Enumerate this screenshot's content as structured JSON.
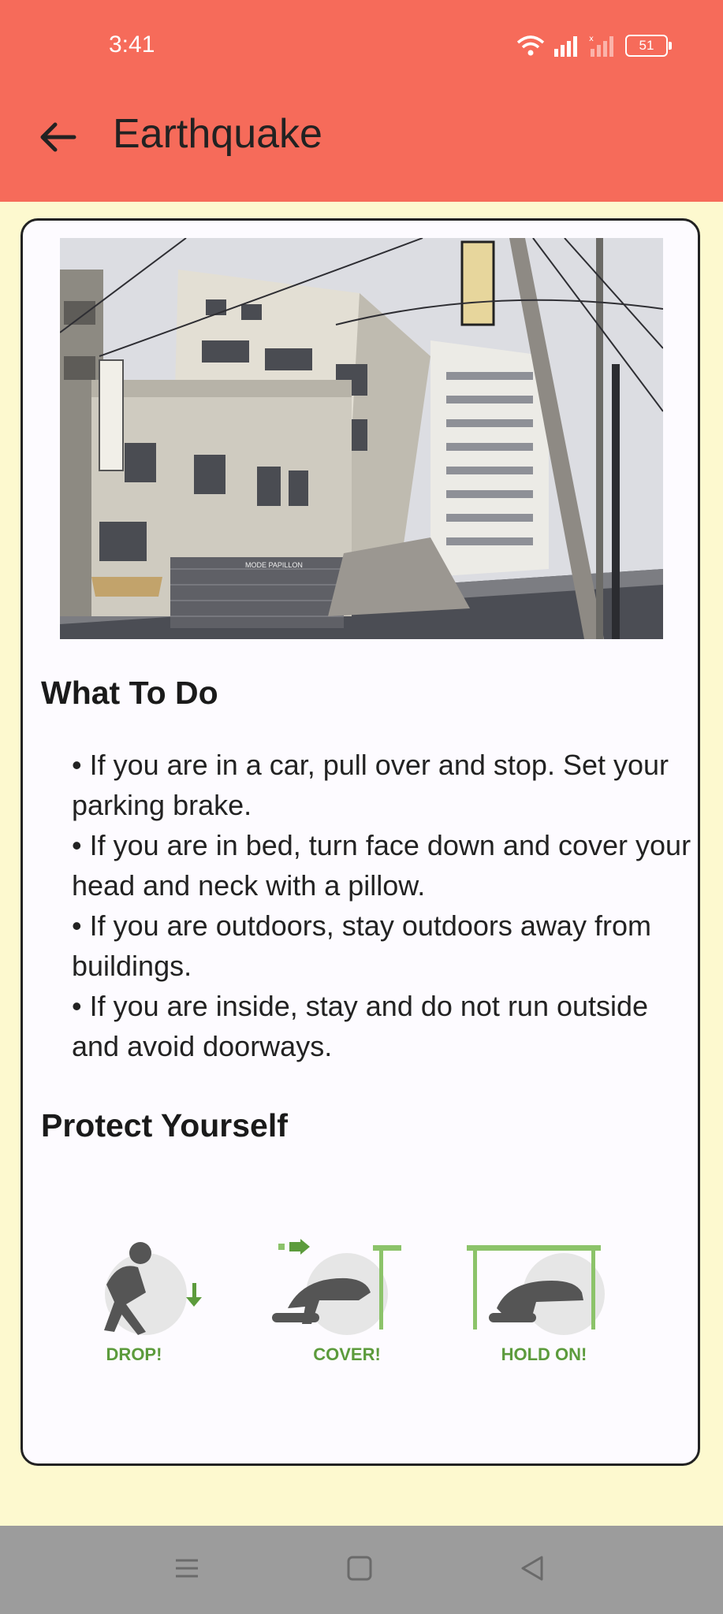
{
  "status_bar": {
    "time": "3:41",
    "battery": "51"
  },
  "header": {
    "title": "Earthquake"
  },
  "what_to_do": {
    "title": "What To Do",
    "items": [
      "• If you are in a car, pull over and stop. Set your parking brake.",
      "• If you are in bed, turn face down and cover your head and neck with a pillow.",
      "• If you are outdoors, stay outdoors away from buildings.",
      "• If you are inside, stay and do not run outside and avoid doorways."
    ]
  },
  "protect_yourself": {
    "title": "Protect Yourself",
    "steps": [
      "DROP!",
      "COVER!",
      "HOLD ON!"
    ]
  },
  "image_sign": "MODE PAPILLON",
  "colors": {
    "appbar": "#f66b5a",
    "background": "#fdf9cf",
    "card": "#fdfbff",
    "step_green": "#5c9b3c"
  }
}
